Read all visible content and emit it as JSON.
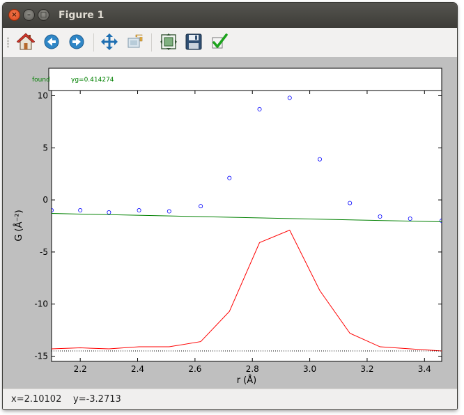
{
  "window": {
    "title": "Figure 1"
  },
  "toolbar": {
    "buttons": [
      {
        "name": "home",
        "icon": "home-icon"
      },
      {
        "name": "back",
        "icon": "back-arrow-icon"
      },
      {
        "name": "forward",
        "icon": "forward-arrow-icon"
      },
      {
        "name": "pan",
        "icon": "pan-move-icon"
      },
      {
        "name": "zoom",
        "icon": "zoom-rect-icon"
      },
      {
        "name": "subplots",
        "icon": "configure-subplots-icon"
      },
      {
        "name": "save",
        "icon": "save-floppy-icon"
      },
      {
        "name": "edit",
        "icon": "checkmark-icon"
      }
    ]
  },
  "status": {
    "x_readout": "x=2.10102",
    "y_readout": "y=-3.2713"
  },
  "legend": {
    "series_label": "found",
    "gamma_label": "γg=0.414274",
    "color": "#008000"
  },
  "chart_data": {
    "type": "line",
    "xlabel": "r (Å)",
    "ylabel": "G (Å⁻²)",
    "xlim": [
      2.1,
      3.46
    ],
    "ylim": [
      -15.5,
      10.5
    ],
    "xticks": [
      "2.2",
      "2.4",
      "2.6",
      "2.8",
      "3.0",
      "3.2",
      "3.4"
    ],
    "yticks": [
      "10",
      "5",
      "0",
      "-5",
      "-10",
      "-15"
    ],
    "xtick_values": [
      2.2,
      2.4,
      2.6,
      2.8,
      3.0,
      3.2,
      3.4
    ],
    "ytick_values": [
      10,
      5,
      0,
      -5,
      -10,
      -15
    ],
    "series": [
      {
        "name": "found",
        "kind": "scatter",
        "marker": "circle-open",
        "color": "#0000ff",
        "x": [
          2.1,
          2.2,
          2.3,
          2.405,
          2.51,
          2.62,
          2.72,
          2.825,
          2.93,
          3.035,
          3.14,
          3.245,
          3.35,
          3.46
        ],
        "y": [
          -1.0,
          -1.0,
          -1.2,
          -1.0,
          -1.1,
          -0.6,
          2.1,
          8.7,
          9.8,
          3.9,
          -0.3,
          -1.6,
          -1.8,
          -2.0
        ]
      },
      {
        "name": "",
        "kind": "line",
        "color": "#008000",
        "x": [
          2.1,
          3.46
        ],
        "y": [
          -1.3,
          -2.1
        ]
      },
      {
        "name": "",
        "kind": "line",
        "color": "#ff0000",
        "x": [
          2.1,
          2.2,
          2.3,
          2.405,
          2.51,
          2.62,
          2.72,
          2.825,
          2.93,
          3.035,
          3.14,
          3.245,
          3.35,
          3.46
        ],
        "y": [
          -14.3,
          -14.2,
          -14.3,
          -14.1,
          -14.1,
          -13.6,
          -10.7,
          -4.1,
          -2.9,
          -8.7,
          -12.8,
          -14.1,
          -14.3,
          -14.5
        ]
      },
      {
        "name": "",
        "kind": "line",
        "style": "dotted",
        "color": "#000000",
        "x": [
          2.1,
          3.46
        ],
        "y": [
          -14.5,
          -14.5
        ]
      }
    ]
  }
}
